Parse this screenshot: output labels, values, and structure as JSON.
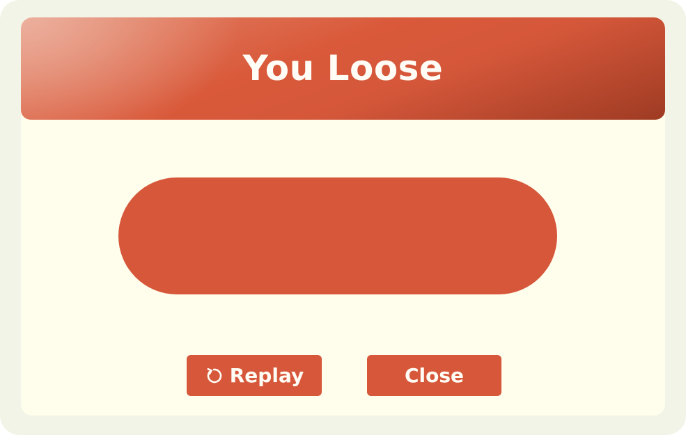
{
  "dialog": {
    "title": "You Loose"
  },
  "actions": {
    "replay_label": "Replay",
    "replay_icon": "replay-icon",
    "close_label": "Close"
  },
  "colors": {
    "accent": "#d6573a",
    "panel_background": "#fffeec",
    "frame_background": "#f3f4e8",
    "text_on_accent": "#fffdf5"
  }
}
